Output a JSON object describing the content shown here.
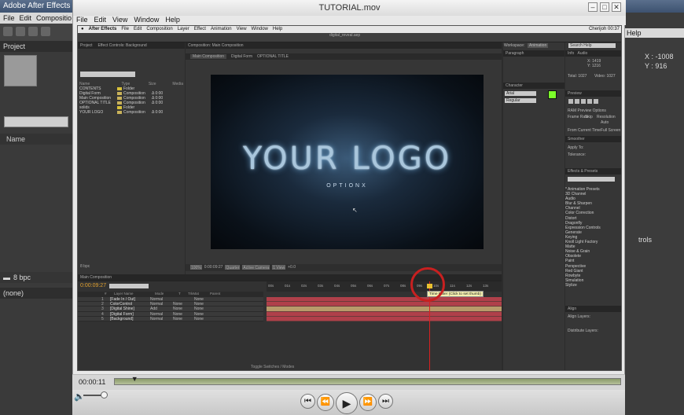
{
  "background_app": {
    "title": "Adobe After Effects - U",
    "menu": [
      "File",
      "Edit",
      "Compositio"
    ],
    "project_tab": "Project",
    "name_col": "Name",
    "bpc": "8 bpc",
    "none_label": "(none)",
    "help": "Help",
    "info_x": "X : -1008",
    "info_y": "Y : 916",
    "trols": "trols"
  },
  "window": {
    "title": "TUTORIAL.mov",
    "minimize": "–",
    "restore": "□",
    "close": "✕",
    "menu": [
      "File",
      "Edit",
      "View",
      "Window",
      "Help"
    ]
  },
  "inner_app": {
    "mac_menu": [
      "After Effects",
      "File",
      "Edit",
      "Composition",
      "Layer",
      "Effect",
      "Animation",
      "View",
      "Window",
      "Help"
    ],
    "mac_clock": "Cherijoh 00:37",
    "file_name": "digital_reveal.aep",
    "project_tab": "Project",
    "effect_controls_tab": "Effect Controls: Background",
    "project_cols": [
      "Name",
      "",
      "Type",
      "Size",
      "Media"
    ],
    "project_items": [
      {
        "name": "CONTENTS",
        "type": "Folder",
        "size": ""
      },
      {
        "name": "Digital Form",
        "type": "Composition",
        "size": "Δ 0:00"
      },
      {
        "name": "Main Composition",
        "type": "Composition",
        "size": "Δ 0:00"
      },
      {
        "name": "OPTIONAL TITLE",
        "type": "Composition",
        "size": "Δ 0:00"
      },
      {
        "name": "solids",
        "type": "Folder",
        "size": ""
      },
      {
        "name": "YOUR LOGO",
        "type": "Composition",
        "size": "Δ 0:00"
      }
    ],
    "project_bpc": "8 bpc",
    "comp_panel_tab": "Composition: Main Composition",
    "comp_tabs": [
      "Main Composition",
      "Digital Form",
      "OPTIONAL TITLE"
    ],
    "logo_text": "YOUR LOGO",
    "subtitle_text": "OPTIONX",
    "comp_bar": [
      "100%",
      "0:00:09:27",
      "Quarter",
      "Active Camera",
      "1 View",
      "+0.0"
    ],
    "workspace_label": "Workspace:",
    "workspace_value": "Animation",
    "search_help": "Search Help",
    "info_tab": "Info",
    "audio_tab": "Audio",
    "info_x": "X: 1419",
    "info_y": "Y: 1216",
    "info_total": "Total: 1027",
    "info_visible": "Video: 1027",
    "research_tab": "Paragraph",
    "character_tab": "Character",
    "font_name": "Arial",
    "font_style": "Regular",
    "preview_tab": "Preview",
    "ram_preview": "RAM Preview Options",
    "frame_rate": "Frame Rate",
    "skip": "Skip",
    "resolution": "Resolution",
    "auto": "Auto",
    "from_current": "From Current Time",
    "full_screen": "Full Screen",
    "smoother_tab": "Smoother",
    "apply_to": "Apply To:",
    "tolerance": "Tolerance:",
    "effects_tab": "Effects & Presets",
    "effects": [
      "* Animation Presets",
      "3D Channel",
      "Audio",
      "Blur & Sharpen",
      "Channel",
      "Color Correction",
      "Distort",
      "Dragonfly",
      "Expression Controls",
      "Generate",
      "Keying",
      "Knoll Light Factory",
      "Matte",
      "Noise & Grain",
      "Obsolete",
      "Paint",
      "Perspective",
      "Red Giant",
      "Rowbyte",
      "Simulation",
      "Stylize"
    ],
    "align_tab": "Align",
    "align_layers": "Align Layers:",
    "distribute_layers": "Distribute Layers:",
    "timeline_tab": "Main Composition",
    "timecode": "0:00:09:27",
    "layer_cols": [
      "#",
      "Layer Name",
      "Mode",
      "T",
      "TrkMat",
      "Parent"
    ],
    "layers": [
      {
        "num": "1",
        "name": "[Fade In / Out]",
        "mode": "Normal",
        "t": "",
        "trk": "",
        "parent": "None"
      },
      {
        "num": "2",
        "name": "ColorControl",
        "mode": "Normal",
        "t": "",
        "trk": "None",
        "parent": "None"
      },
      {
        "num": "3",
        "name": "[Digital Shine]",
        "mode": "Add",
        "t": "",
        "trk": "None",
        "parent": "None"
      },
      {
        "num": "4",
        "name": "[Digital Form]",
        "mode": "Normal",
        "t": "",
        "trk": "None",
        "parent": "None"
      },
      {
        "num": "5",
        "name": "[Background]",
        "mode": "Normal",
        "t": "",
        "trk": "None",
        "parent": "None"
      }
    ],
    "ruler": [
      "00s",
      "01s",
      "02s",
      "03s",
      "04s",
      "05s",
      "06s",
      "07s",
      "08s",
      "09s",
      "10s",
      "11s",
      "12s",
      "13s"
    ],
    "tooltip": "Time Ruler (Click to set thumb)",
    "toggle": "Toggle Switches / Modes"
  },
  "player": {
    "time": "00:00:11",
    "progress": 0.04,
    "buttons": [
      "⏮",
      "⏪",
      "▶",
      "⏩",
      "⏭"
    ]
  },
  "colors": {
    "accent": "#d92020",
    "track_red": "#b0404a",
    "track_tan": "#b89a6a"
  }
}
